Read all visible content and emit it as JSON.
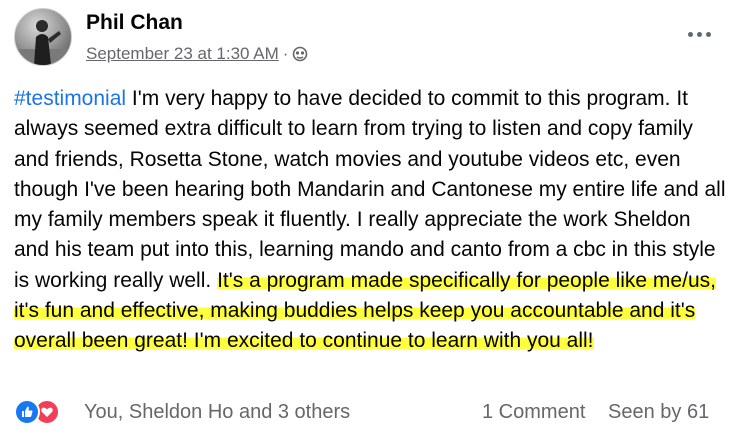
{
  "post": {
    "author": "Phil Chan",
    "timestamp": "September 23 at 1:30 AM",
    "separator": "·",
    "audience_icon": "globe-icon",
    "more_icon": "more-options-icon",
    "body": {
      "hashtag": "#testimonial",
      "text_plain": " I'm very happy to have decided to commit to this program. It always seemed extra difficult to learn from trying to listen and copy family and friends, Rosetta Stone, watch movies and youtube videos etc, even though I've been hearing both Mandarin and Cantonese my entire life and all my family members speak it fluently. I really appreciate the work Sheldon and his team put into this, learning mando and canto from a cbc in this style is working really well. ",
      "text_highlighted": "It's a program made specifically for people like me/us, it's fun and effective, making buddies helps keep you accountable and it's overall been great! I'm excited to continue to learn with you all!"
    },
    "footer": {
      "reaction_icons": [
        "like-icon",
        "love-icon"
      ],
      "reactions_text": "You, Sheldon Ho and 3 others",
      "comments_text": "1 Comment",
      "seen_text": "Seen by 61"
    }
  },
  "colors": {
    "hashtag": "#1b74e4",
    "highlight": "#ffff3d",
    "secondary_text": "#65676b",
    "like": "#1877f2",
    "love": "#f33e58"
  }
}
